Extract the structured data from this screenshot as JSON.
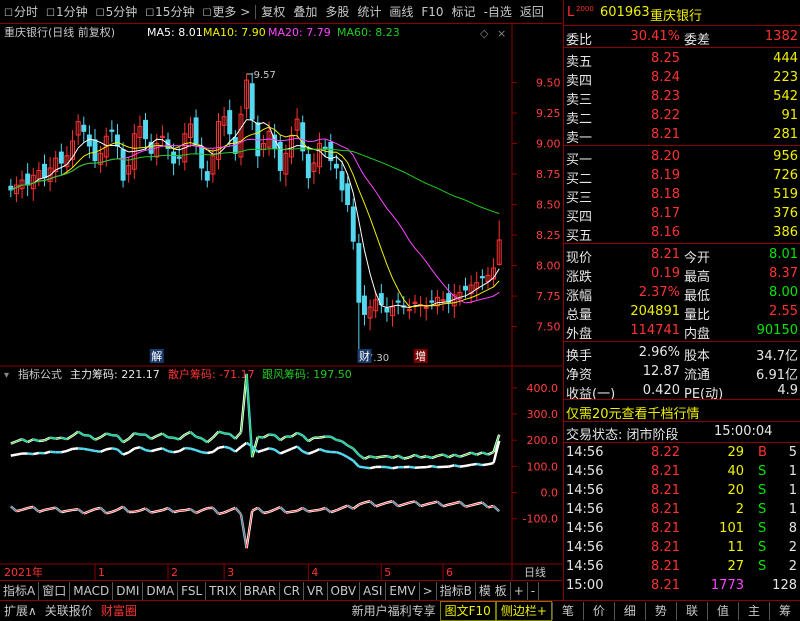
{
  "toolbar": {
    "items": [
      "分时",
      "1分钟",
      "5分钟",
      "15分钟",
      "更多 >",
      "复权",
      "叠加",
      "多股",
      "统计",
      "画线",
      "F10",
      "标记",
      "-自选",
      "返回"
    ]
  },
  "chart_header": {
    "title": "重庆银行(日线 前复权)",
    "ma5": "MA5: 8.01",
    "ma10": "MA10: 7.90",
    "ma20": "MA20: 7.79",
    "ma60": "MA60: 8.23"
  },
  "indicator_header": {
    "name": "指标公式",
    "main": "主力筹码: 221.17",
    "retail": "散户筹码: -71.17",
    "follow": "跟风筹码: 197.50"
  },
  "markers": {
    "jie": "解",
    "cai": "财",
    "zeng": "增",
    "high": "9.57",
    "low": "7.30"
  },
  "axis_bottom": {
    "year": "2021年",
    "months": [
      "1",
      "2",
      "3",
      "4",
      "5",
      "6"
    ],
    "period": "日线"
  },
  "colors": {
    "up": "#ff3232",
    "down": "#54d8f0",
    "ma5": "#ffffff",
    "ma10": "#f0f000",
    "ma20": "#ff44ff",
    "ma60": "#22cc22",
    "border": "#8b0000"
  },
  "chart_data": [
    {
      "type": "candlestick",
      "title": "重庆银行(日线 前复权)",
      "yticks": [
        9.5,
        9.25,
        9.0,
        8.75,
        8.5,
        8.25,
        8.0,
        7.75,
        7.5
      ],
      "ylim": [
        7.3,
        9.57
      ],
      "annotations": [
        {
          "label": "9.57",
          "type": "high"
        },
        {
          "label": "7.30",
          "type": "low"
        }
      ],
      "series": [
        {
          "name": "MA5",
          "last": 8.01
        },
        {
          "name": "MA10",
          "last": 7.9
        },
        {
          "name": "MA20",
          "last": 7.79
        },
        {
          "name": "MA60",
          "last": 8.23
        }
      ],
      "closes": [
        8.62,
        8.66,
        8.7,
        8.66,
        8.74,
        8.78,
        8.72,
        8.8,
        8.88,
        8.84,
        8.9,
        9.02,
        9.18,
        9.1,
        8.98,
        8.86,
        8.92,
        9.06,
        9.1,
        8.98,
        8.7,
        8.82,
        9.08,
        9.14,
        9.04,
        8.92,
        9.0,
        9.06,
        8.96,
        8.84,
        8.88,
        9.08,
        9.16,
        9.0,
        8.8,
        8.7,
        8.9,
        9.18,
        9.22,
        9.08,
        8.92,
        9.24,
        9.52,
        9.2,
        8.9,
        9.0,
        9.1,
        8.96,
        8.78,
        8.92,
        9.06,
        9.2,
        8.94,
        8.72,
        8.84,
        9.0,
        8.96,
        8.86,
        8.8,
        8.62,
        8.5,
        8.2,
        7.7,
        7.6,
        7.66,
        7.72,
        7.68,
        7.62,
        7.66,
        7.7,
        7.66,
        7.64,
        7.7,
        7.68,
        7.66,
        7.7,
        7.74,
        7.72,
        7.7,
        7.76,
        7.78,
        7.8,
        7.84,
        7.86,
        7.9,
        7.92,
        7.98,
        8.21
      ]
    },
    {
      "type": "line",
      "title": "指标公式",
      "yticks": [
        400.0,
        300.0,
        200.0,
        100.0,
        0.0,
        -100.0
      ],
      "ylim": [
        -250,
        430
      ],
      "series": [
        {
          "name": "主力筹码",
          "last": 221.17
        },
        {
          "name": "散户筹码",
          "last": -71.17
        },
        {
          "name": "跟风筹码",
          "last": 197.5
        }
      ]
    }
  ],
  "quote": {
    "code": "601963",
    "name": "重庆银行",
    "l_label": "L",
    "l_sub": "2000",
    "weibi_label": "委比",
    "weibi": "30.41%",
    "weicha_label": "委差",
    "weicha": "1382",
    "sell": [
      {
        "label": "卖五",
        "price": "8.25",
        "vol": "444"
      },
      {
        "label": "卖四",
        "price": "8.24",
        "vol": "223"
      },
      {
        "label": "卖三",
        "price": "8.23",
        "vol": "542"
      },
      {
        "label": "卖二",
        "price": "8.22",
        "vol": "91"
      },
      {
        "label": "卖一",
        "price": "8.21",
        "vol": "281"
      }
    ],
    "buy": [
      {
        "label": "买一",
        "price": "8.20",
        "vol": "956"
      },
      {
        "label": "买二",
        "price": "8.19",
        "vol": "726"
      },
      {
        "label": "买三",
        "price": "8.18",
        "vol": "519"
      },
      {
        "label": "买四",
        "price": "8.17",
        "vol": "376"
      },
      {
        "label": "买五",
        "price": "8.16",
        "vol": "386"
      }
    ],
    "stats": [
      {
        "l1": "现价",
        "v1": "8.21",
        "l2": "今开",
        "v2": "8.01"
      },
      {
        "l1": "涨跌",
        "v1": "0.19",
        "l2": "最高",
        "v2": "8.37"
      },
      {
        "l1": "涨幅",
        "v1": "2.37%",
        "l2": "最低",
        "v2": "8.00"
      },
      {
        "l1": "总量",
        "v1": "204891",
        "l2": "量比",
        "v2": "2.55"
      },
      {
        "l1": "外盘",
        "v1": "114741",
        "l2": "内盘",
        "v2": "90150"
      }
    ],
    "stats2": [
      {
        "l1": "换手",
        "v1": "2.96%",
        "l2": "股本",
        "v2": "34.7亿"
      },
      {
        "l1": "净资",
        "v1": "12.87",
        "l2": "流通",
        "v2": "6.91亿"
      },
      {
        "l1": "收益(一)",
        "v1": "0.420",
        "l2": "PE(动)",
        "v2": "4.9"
      }
    ],
    "promo": "仅需20元查看千档行情",
    "status_label": "交易状态: 闭市阶段",
    "status_time": "15:00:04",
    "ticks": [
      {
        "t": "14:56",
        "p": "8.22",
        "v": "29",
        "s": "B",
        "n": "5"
      },
      {
        "t": "14:56",
        "p": "8.21",
        "v": "40",
        "s": "S",
        "n": "1"
      },
      {
        "t": "14:56",
        "p": "8.21",
        "v": "20",
        "s": "S",
        "n": "1"
      },
      {
        "t": "14:56",
        "p": "8.21",
        "v": "2",
        "s": "S",
        "n": "1"
      },
      {
        "t": "14:56",
        "p": "8.21",
        "v": "101",
        "s": "S",
        "n": "8"
      },
      {
        "t": "14:56",
        "p": "8.21",
        "v": "11",
        "s": "S",
        "n": "2"
      },
      {
        "t": "14:56",
        "p": "8.21",
        "v": "27",
        "s": "S",
        "n": "2"
      },
      {
        "t": "15:00",
        "p": "8.21",
        "v": "1773",
        "s": "",
        "n": "128"
      }
    ]
  },
  "tabs": [
    "指标A",
    "窗口",
    "MACD",
    "DMI",
    "DMA",
    "FSL",
    "TRIX",
    "BRAR",
    "CR",
    "VR",
    "OBV",
    "ASI",
    "EMV",
    ">",
    "指标B",
    "模 板",
    "+",
    "-"
  ],
  "statusbar": {
    "left": [
      "扩展∧",
      "关联报价",
      "财富圈"
    ],
    "promo": "新用户福利专享",
    "f10": "图文F10",
    "side": "侧边栏+",
    "right": [
      "笔",
      "价",
      "细",
      "势",
      "联",
      "值",
      "主",
      "筹"
    ]
  }
}
